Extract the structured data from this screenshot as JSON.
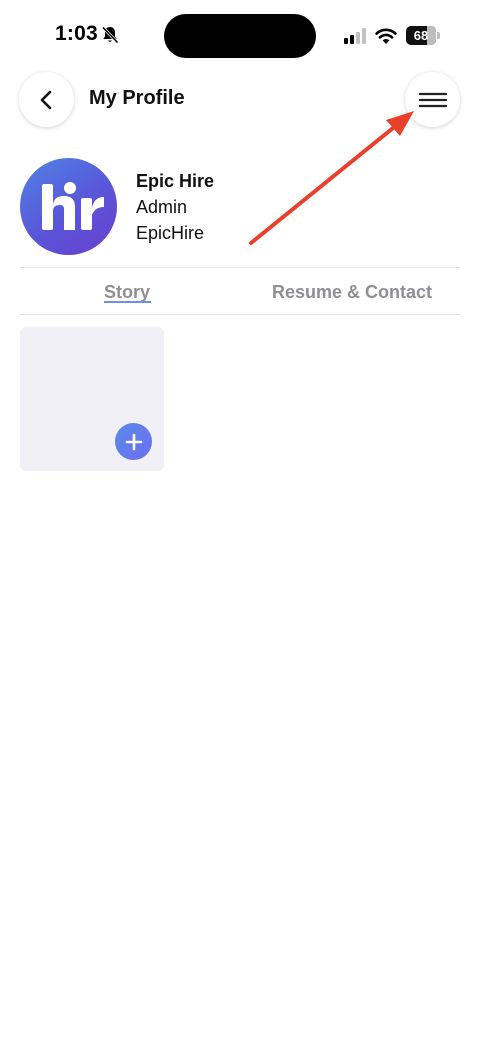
{
  "status_bar": {
    "time": "1:03",
    "battery_level": "68",
    "icons": [
      "bell-slash-icon",
      "signal-icon",
      "wifi-icon",
      "battery-icon"
    ]
  },
  "header": {
    "title": "My Profile",
    "back_icon": "chevron-left-icon",
    "menu_icon": "hamburger-menu-icon"
  },
  "profile": {
    "name": "Epic Hire",
    "role": "Admin",
    "company": "EpicHire",
    "avatar_logo_text": "hr"
  },
  "tabs": [
    {
      "label": "Story",
      "active": true
    },
    {
      "label": "Resume & Contact",
      "active": false
    }
  ],
  "story": {
    "add_icon": "plus-icon"
  },
  "colors": {
    "accent": "#6e8fe8",
    "annotation_arrow": "#e8402a",
    "avatar_gradient_start": "#4f84e6",
    "avatar_gradient_end": "#6a3fcf"
  }
}
